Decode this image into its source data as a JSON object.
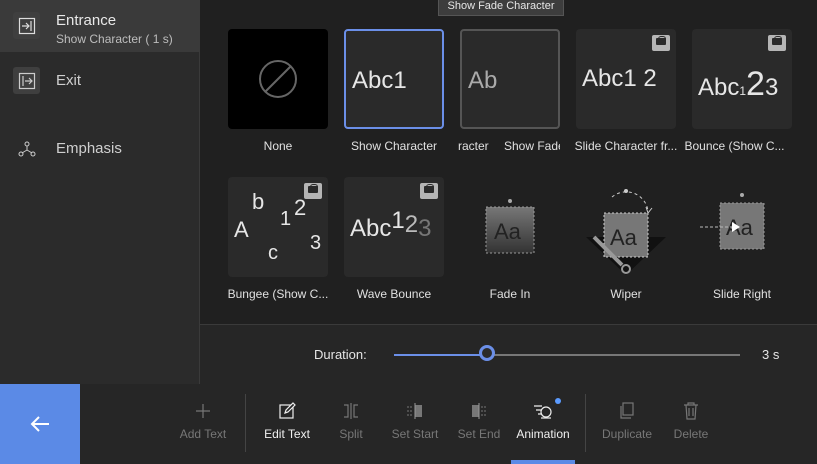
{
  "sidebar": {
    "items": [
      {
        "label": "Entrance",
        "sub": "Show Character ( 1 s)",
        "icon": "entrance-icon"
      },
      {
        "label": "Exit",
        "icon": "exit-icon"
      },
      {
        "label": "Emphasis",
        "icon": "emphasis-icon"
      }
    ]
  },
  "tooltip": "Show Fade Character",
  "animations": [
    {
      "caption": "None",
      "preview": ""
    },
    {
      "caption": "Show Character",
      "preview": "Abc1"
    },
    {
      "caption": "racter",
      "preview": "Ab"
    },
    {
      "caption": "Show Fade",
      "preview": ""
    },
    {
      "caption": "Slide Character fr...",
      "preview": "Abc1 2"
    },
    {
      "caption": "Bounce (Show C...",
      "preview": "Abc123"
    },
    {
      "caption": "Bungee (Show C...",
      "preview": "Abc123"
    },
    {
      "caption": "Wave Bounce",
      "preview": "Abc123"
    },
    {
      "caption": "Fade In",
      "preview": "Aa"
    },
    {
      "caption": "Wiper",
      "preview": "Aa"
    },
    {
      "caption": "Slide Right",
      "preview": "Aa"
    }
  ],
  "duration": {
    "label": "Duration:",
    "value": "3 s",
    "level": 0.27
  },
  "toolbar": {
    "add_text": "Add Text",
    "edit_text": "Edit Text",
    "split": "Split",
    "set_start": "Set Start",
    "set_end": "Set End",
    "animation": "Animation",
    "duplicate": "Duplicate",
    "delete": "Delete"
  },
  "colors": {
    "accent": "#5b8ae6",
    "selected_border": "#6b8fe8"
  }
}
